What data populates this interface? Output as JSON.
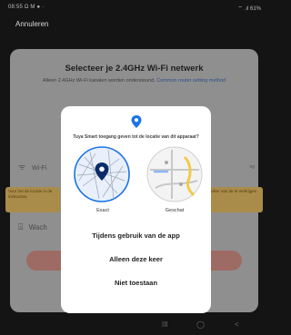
{
  "status": {
    "left": "08:55 Ω M ● ·",
    "right": "⌔ .ıl 61%"
  },
  "header": {
    "cancel_label": "Annuleren"
  },
  "background": {
    "title": "Selecteer je 2.4GHz Wi-Fi netwerk",
    "subtitle": "Alleen 2.4GHz Wi-Fi kanalen worden ondersteund.",
    "subtitle_link": "Common router setting method",
    "wifi_label": "Wi-Fi",
    "wifi_right": "ng",
    "warn_left": "Voor het de locatie in de instructies.",
    "warn_right": "uiker van de te verkrijgen",
    "password_label": "Wach"
  },
  "dialog": {
    "title": "Tuya Smart toegang geven tot de locatie van dit apparaat?",
    "exact_label": "Exact",
    "approx_label": "Geschat",
    "options": [
      "Tijdens gebruik van de app",
      "Alleen deze keer",
      "Niet toestaan"
    ],
    "accent": "#1a73e8"
  },
  "navbar": {
    "items": [
      "III",
      "◯",
      "<"
    ]
  }
}
